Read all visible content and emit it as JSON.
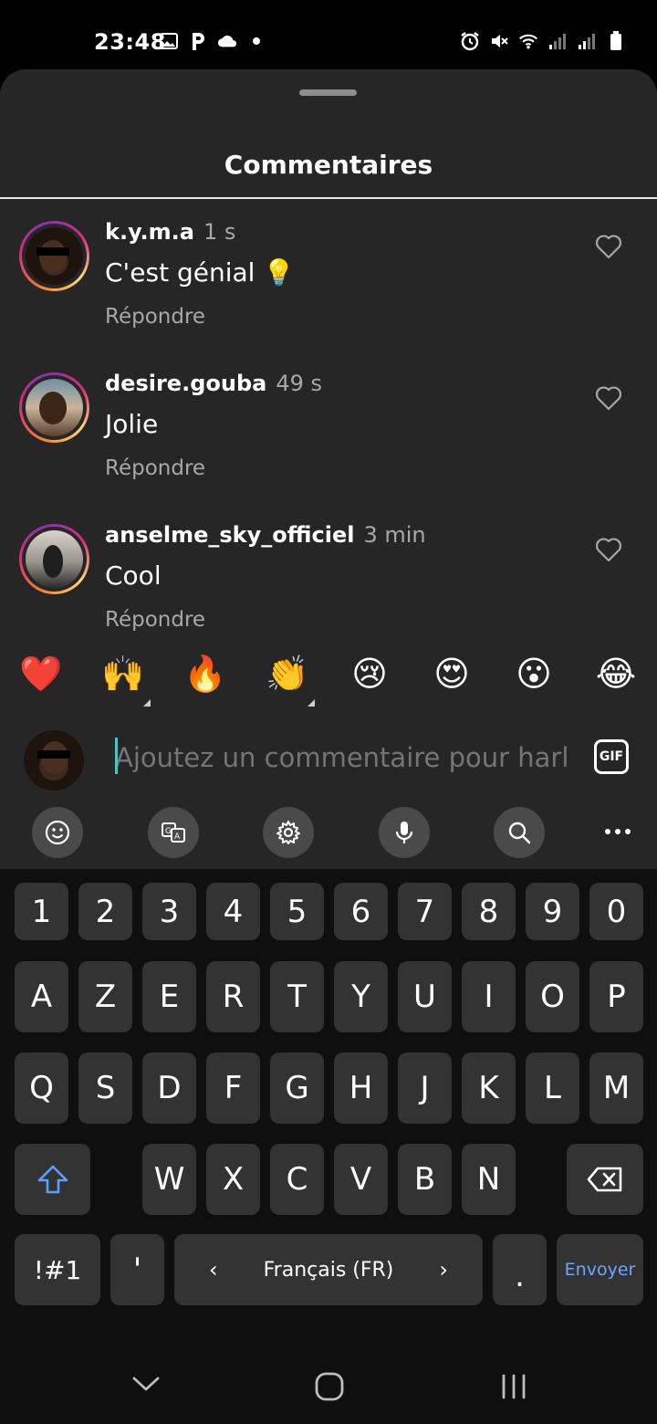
{
  "status_bar": {
    "time": "23:48",
    "left_icons": [
      "gallery-icon",
      "parking-app-icon",
      "cloud-icon",
      "dot-icon"
    ],
    "right_icons": [
      "alarm-icon",
      "mute-icon",
      "wifi-icon",
      "signal-icon",
      "signal-icon",
      "battery-icon"
    ]
  },
  "sheet": {
    "title": "Commentaires"
  },
  "comments": [
    {
      "username": "k.y.m.a",
      "time": "1 s",
      "text": "C'est génial 💡",
      "reply_label": "Répondre"
    },
    {
      "username": "desire.gouba",
      "time": "49 s",
      "text": "Jolie",
      "reply_label": "Répondre"
    },
    {
      "username": "anselme_sky_officiel",
      "time": "3 min",
      "text": "Cool",
      "reply_label": "Répondre"
    }
  ],
  "quick_emojis": [
    "❤️",
    "🙌",
    "🔥",
    "👏",
    "😢",
    "😍",
    "😮",
    "😂"
  ],
  "comment_input": {
    "placeholder": "Ajoutez un commentaire pour harle",
    "gif_label": "GIF"
  },
  "keyboard": {
    "toolbar": [
      "emoji-icon",
      "translate-icon",
      "settings-icon",
      "mic-icon",
      "search-icon",
      "more-icon"
    ],
    "row_numbers": [
      "1",
      "2",
      "3",
      "4",
      "5",
      "6",
      "7",
      "8",
      "9",
      "0"
    ],
    "row_1": [
      "A",
      "Z",
      "E",
      "R",
      "T",
      "Y",
      "U",
      "I",
      "O",
      "P"
    ],
    "row_2": [
      "Q",
      "S",
      "D",
      "F",
      "G",
      "H",
      "J",
      "K",
      "L",
      "M"
    ],
    "row_3": [
      "W",
      "X",
      "C",
      "V",
      "B",
      "N"
    ],
    "symbols_label": "!#1",
    "apostrophe_label": "'",
    "language_label": "Français (FR)",
    "period_label": ".",
    "enter_label": "Envoyer"
  },
  "colors": {
    "sheet_bg": "#262626",
    "key_bg": "#333333",
    "accent_blue": "#6aa6ff",
    "secondary_text": "#a8a8a8"
  }
}
